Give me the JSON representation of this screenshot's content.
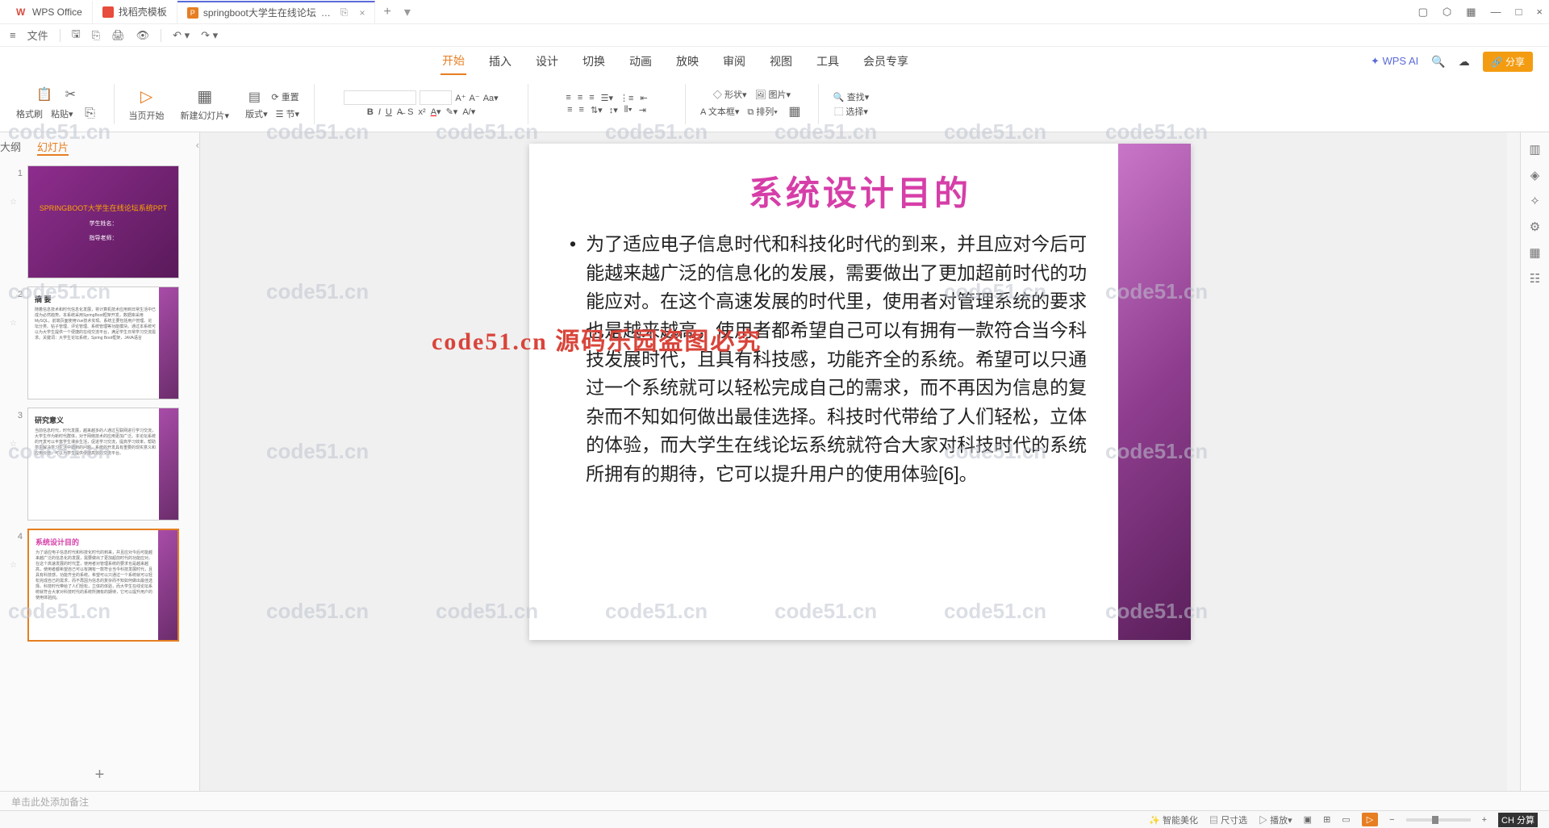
{
  "tabs": [
    {
      "icon": "wps",
      "label": "WPS Office"
    },
    {
      "icon": "doc-red",
      "label": "找稻壳模板"
    },
    {
      "icon": "ppt",
      "label": "springboot大学生在线论坛",
      "active": true
    }
  ],
  "quickbar": {
    "file": "文件"
  },
  "menu": {
    "items": [
      "开始",
      "插入",
      "设计",
      "切换",
      "动画",
      "放映",
      "审阅",
      "视图",
      "工具",
      "会员专享"
    ],
    "active": 0,
    "ai": "WPS AI",
    "share": "分享"
  },
  "ribbon": {
    "format_painter": "格式刷",
    "paste": "粘贴",
    "from_current": "当页开始",
    "new_slide": "新建幻灯片",
    "layout": "版式",
    "section": "节",
    "reset": "重置",
    "shape": "形状",
    "picture": "图片",
    "textbox": "文本框",
    "arrange": "排列",
    "find": "查找",
    "select": "选择"
  },
  "sidebar": {
    "tabs": {
      "outline": "大纲",
      "slides": "幻灯片"
    },
    "thumbs": [
      {
        "n": "1",
        "type": "title",
        "title": "SPRINGBOOT大学生在线论坛系统PPT",
        "sub1": "学生姓名：",
        "sub2": "指导老师："
      },
      {
        "n": "2",
        "type": "text",
        "title": "摘 要",
        "body": "随着信息技术和时代信息化发展，将计算机技术应用到日常生活中已成为必然趋势。本系统采用SpringBoot框架开发，数据库采用MySQL，前端页面使用Vue技术实现。系统主要包括用户管理、论坛分类、帖子管理、评论管理、系统管理等功能模块。通过本系统可以为大学生提供一个便捷的在线交流平台，满足学生日常学习交流需求。关键词：大学生论坛系统，Spring Boot框架，JAVA语言"
      },
      {
        "n": "3",
        "type": "text",
        "title": "研究意义",
        "body": "当前信息时代，时代发展，越来越多的人通过互联网进行学习交流，大学生作为新时代群体，对于网络技术的应用更加广泛。本论坛系统的开发可以丰富学生课余生活，促进学习交流，提高学习效率，帮助学生解决学习生活中遇到的问题。系统的开发具有重要的现实意义和应用价值，可以为学生提供便捷高效的交流平台。"
      },
      {
        "n": "4",
        "type": "text",
        "title": "系统设计目的",
        "title_pink": true,
        "sel": true,
        "body": "为了适应电子信息时代和科技化时代的到来，并且应对今后可能越来越广泛的信息化的发展，需要做出了更加超前时代的功能应对。在这个高速发展的时代里，使用者对管理系统的要求也是越来越高，使用者都希望自己可以有拥有一款符合当今科技发展时代，且具有科技感，功能齐全的系统。希望可以只通过一个系统就可以轻松完成自己的需求，而不再因为信息的复杂而不知如何做出最佳选择。科技时代带给了人们轻松，立体的体验，而大学生在线论坛系统就符合大家对科技时代的系统所拥有的期待，它可以提升用户的使用体验[6]。"
      }
    ]
  },
  "slide": {
    "title": "系统设计目的",
    "body": "为了适应电子信息时代和科技化时代的到来，并且应对今后可能越来越广泛的信息化的发展，需要做出了更加超前时代的功能应对。在这个高速发展的时代里，使用者对管理系统的要求也是越来越高，使用者都希望自己可以有拥有一款符合当今科技发展时代，且具有科技感，功能齐全的系统。希望可以只通过一个系统就可以轻松完成自己的需求，而不再因为信息的复杂而不知如何做出最佳选择。科技时代带给了人们轻松，立体的体验，而大学生在线论坛系统就符合大家对科技时代的系统所拥有的期待，它可以提升用户的使用体验[6]。"
  },
  "notes": {
    "placeholder": "单击此处添加备注"
  },
  "status": {
    "smart": "智能美化",
    "template": "尺寸选",
    "play": "播放",
    "ch": "CH 分算"
  },
  "watermark": {
    "text": "code51.cn",
    "red": "code51.cn 源码乐园盗图必究"
  }
}
